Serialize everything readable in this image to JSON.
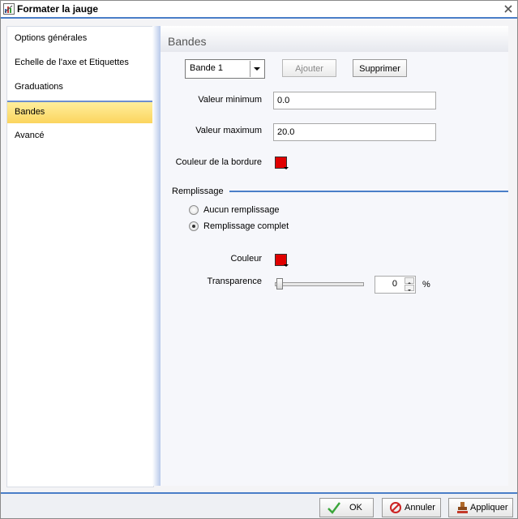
{
  "window": {
    "title": "Formater la jauge"
  },
  "sidebar": {
    "items": [
      {
        "label": "Options générales"
      },
      {
        "label": "Echelle de l'axe et Etiquettes"
      },
      {
        "label": "Graduations"
      },
      {
        "label": "Bandes",
        "active": true
      },
      {
        "label": "Avancé"
      }
    ]
  },
  "panel": {
    "title": "Bandes",
    "band_select": {
      "value": "Bande 1"
    },
    "add_button": "Ajouter",
    "delete_button": "Supprimer",
    "min_label": "Valeur minimum",
    "min_value": "0.0",
    "max_label": "Valeur maximum",
    "max_value": "20.0",
    "border_color_label": "Couleur de la bordure",
    "border_color": "#e00000",
    "fill_section": "Remplissage",
    "fill_options": [
      {
        "label": "Aucun remplissage",
        "selected": false
      },
      {
        "label": "Remplissage complet",
        "selected": true
      }
    ],
    "color_label": "Couleur",
    "fill_color": "#e00000",
    "transparency_label": "Transparence",
    "transparency_value": "0",
    "transparency_unit": "%"
  },
  "footer": {
    "ok_label": "OK",
    "cancel_label": "Annuler",
    "apply_label": "Appliquer"
  },
  "colors": {
    "accent": "#4a7ec8",
    "active_item": "#fbd55e"
  }
}
